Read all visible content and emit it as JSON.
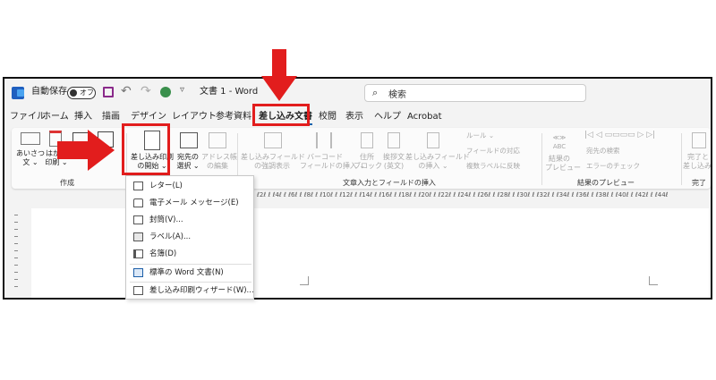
{
  "titlebar": {
    "autosave_label": "自動保存",
    "autosave_state": "オフ",
    "doc_title": "文書 1  -  Word",
    "search_placeholder": "検索"
  },
  "tabs": [
    "ファイル",
    "ホーム",
    "挿入",
    "描画",
    "デザイン",
    "レイアウト",
    "参考資料",
    "差し込み文書",
    "校閲",
    "表示",
    "ヘルプ",
    "Acrobat"
  ],
  "active_tab": "差し込み文書",
  "ribbon": {
    "create": {
      "greeting": [
        "あいさつ",
        "文 ⌄"
      ],
      "postcard": [
        "はがき",
        "印刷 ⌄"
      ],
      "group": "作成"
    },
    "start_merge": [
      "差し込み印刷",
      "の開始 ⌄"
    ],
    "recipients": [
      "宛先の",
      "選択 ⌄"
    ],
    "edit_list": [
      "アドレス帳",
      "の編集"
    ],
    "highlight": [
      "差し込みフィールド",
      "の強調表示"
    ],
    "barcode": [
      "バーコード",
      "フィールドの挿入 ⌄"
    ],
    "address_block": [
      "住所",
      "ブロック"
    ],
    "greeting_line": [
      "挨拶文",
      "(英文)"
    ],
    "insert_field": [
      "差し込みフィールド",
      "の挿入 ⌄"
    ],
    "rules": "ルール ⌄",
    "match_fields": "フィールドの対応",
    "update_labels": "複数ラベルに反映",
    "write_group": "文章入力とフィールドの挿入",
    "preview_results": [
      "結果の",
      "プレビュー"
    ],
    "find_recipient": "宛先の検索",
    "check_errors": "エラーのチェック",
    "preview_group": "結果のプレビュー",
    "finish": [
      "完了と",
      "差し込み ⌄"
    ],
    "finish_group": "完了"
  },
  "ruler_marks": "ℓ2ℓ ℓ ℓ4ℓ ℓ ℓ6ℓ ℓ ℓ8ℓ ℓ ℓ10ℓ ℓ ℓ12ℓ ℓ ℓ14ℓ ℓ ℓ16ℓ ℓ ℓ18ℓ ℓ ℓ20ℓ ℓ ℓ22ℓ ℓ ℓ24ℓ ℓ ℓ26ℓ ℓ ℓ28ℓ ℓ ℓ30ℓ ℓ ℓ32ℓ ℓ ℓ34ℓ ℓ ℓ36ℓ ℓ ℓ38ℓ ℓ ℓ40ℓ ℓ ℓ42ℓ ℓ ℓ44ℓ",
  "dropdown": [
    {
      "label": "レター(L)",
      "icon": "letter-icon"
    },
    {
      "label": "電子メール メッセージ(E)",
      "icon": "email-icon"
    },
    {
      "label": "封筒(V)...",
      "icon": "envelope-icon"
    },
    {
      "label": "ラベル(A)...",
      "icon": "label-icon"
    },
    {
      "label": "名簿(D)",
      "icon": "directory-icon"
    },
    {
      "label": "標準の Word 文書(N)",
      "icon": "word-doc-icon"
    },
    {
      "label": "差し込み印刷ウィザード(W)...",
      "icon": "wizard-icon"
    }
  ],
  "colors": {
    "highlight_red": "#e21d1d",
    "accent_blue": "#1d5fa8"
  }
}
